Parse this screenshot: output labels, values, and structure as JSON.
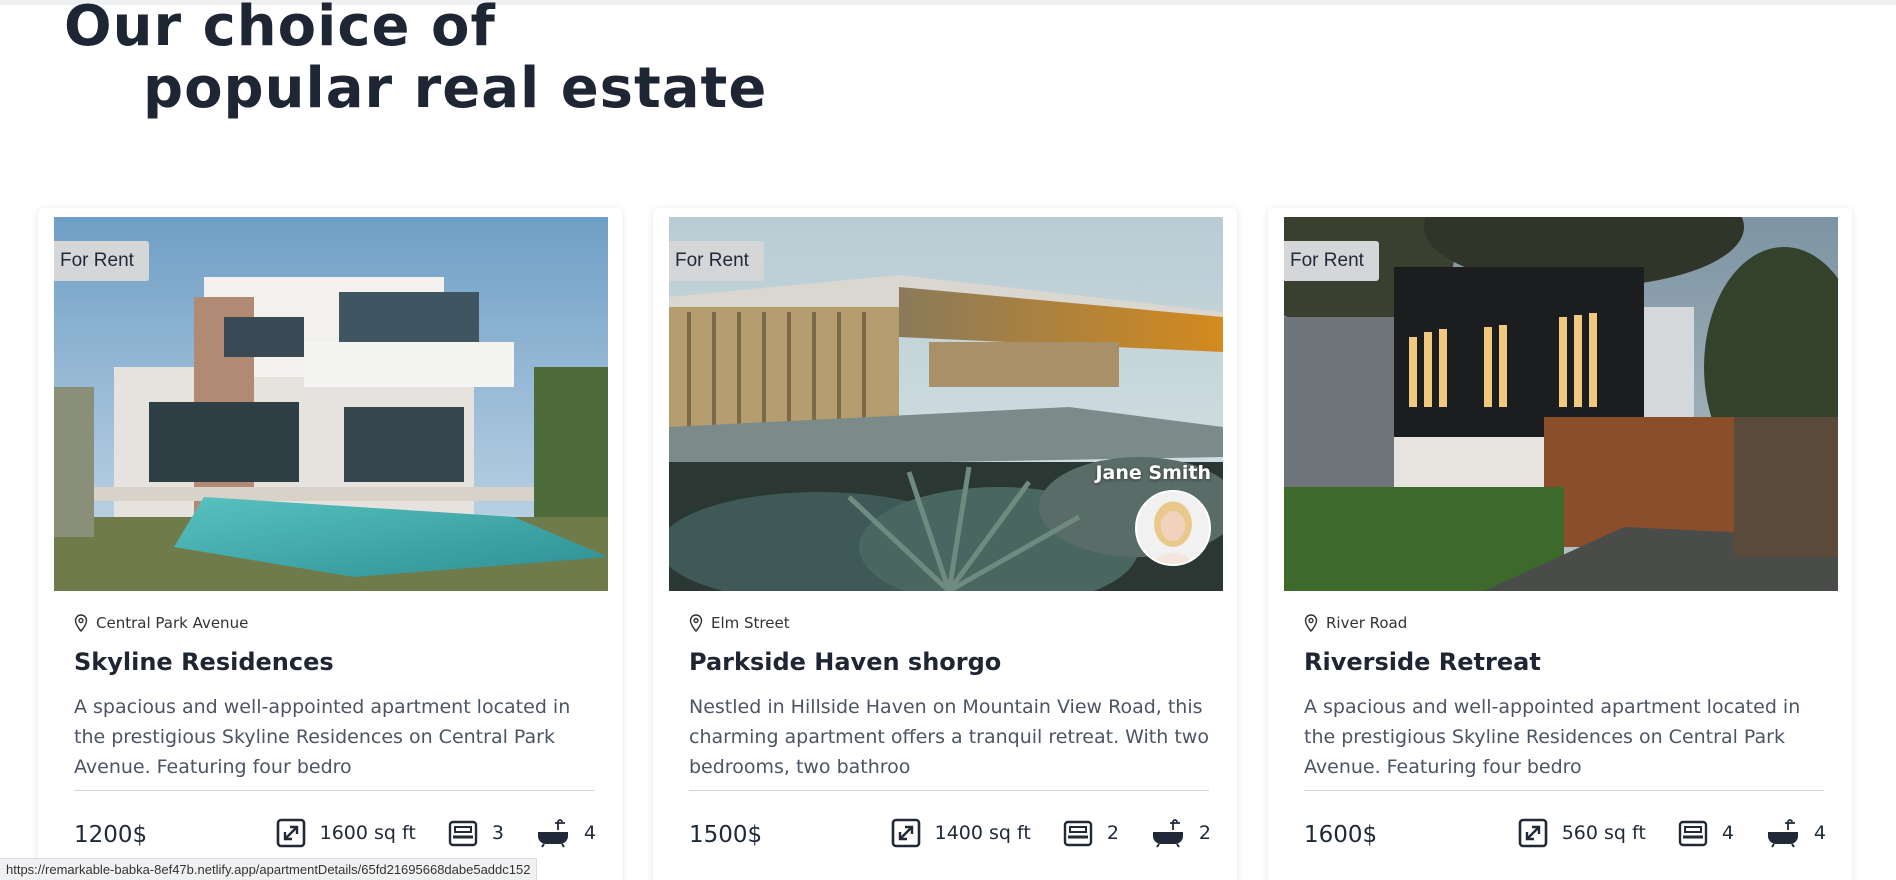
{
  "heading": {
    "line1": "Our choice of",
    "line2": "popular real estate"
  },
  "cards": [
    {
      "badge": "For Rent",
      "location": "Central Park Avenue",
      "title": "Skyline Residences",
      "description": "A spacious and well-appointed apartment located in the prestigious Skyline Residences on Central Park Avenue. Featuring four bedro",
      "price": "1200$",
      "area": "1600 sq ft",
      "bedrooms": "3",
      "bathrooms": "4"
    },
    {
      "badge": "For Rent",
      "agent_name": "Jane Smith",
      "location": "Elm Street",
      "title": "Parkside Haven shorgo",
      "description": "Nestled in Hillside Haven on Mountain View Road, this charming apartment offers a tranquil retreat. With two bedrooms, two bathroo",
      "price": "1500$",
      "area": "1400 sq ft",
      "bedrooms": "2",
      "bathrooms": "2"
    },
    {
      "badge": "For Rent",
      "location": "River Road",
      "title": "Riverside Retreat",
      "description": "A spacious and well-appointed apartment located in the prestigious Skyline Residences on Central Park Avenue. Featuring four bedro",
      "price": "1600$",
      "area": "560 sq ft",
      "bedrooms": "4",
      "bathrooms": "4"
    }
  ],
  "status_bar": {
    "url": "https://remarkable-babka-8ef47b.netlify.app/apartmentDetails/65fd21695668dabe5addc152"
  },
  "icons": {
    "location": "map-pin-icon",
    "area": "expand-icon",
    "bedrooms": "bed-icon",
    "bathrooms": "bathtub-icon"
  }
}
